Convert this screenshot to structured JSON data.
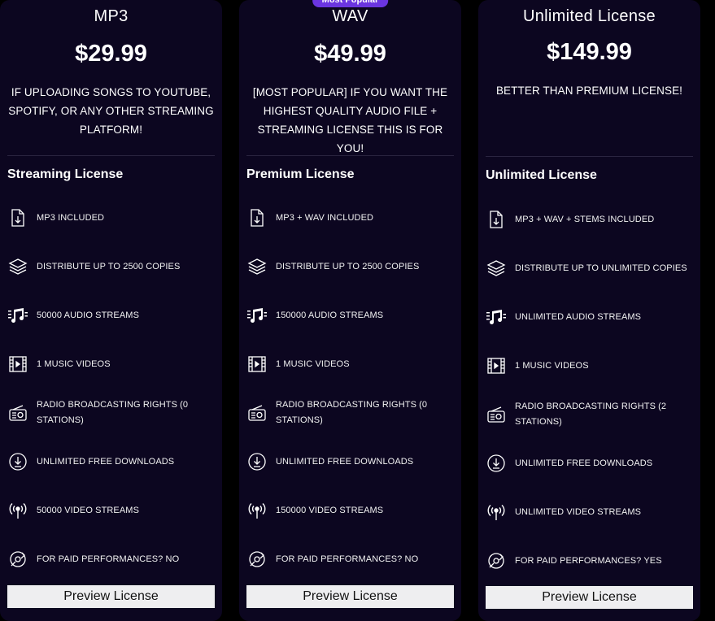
{
  "cards": [
    {
      "name": "MP3",
      "price": "$29.99",
      "description": "IF UPLOADING SONGS TO YOUTUBE, SPOTIFY, OR ANY OTHER STREAMING PLATFORM!",
      "license_title": "Streaming License",
      "features": [
        {
          "icon": "file-download-icon",
          "text": "MP3 INCLUDED"
        },
        {
          "icon": "layers-icon",
          "text": "DISTRIBUTE UP TO 2500 COPIES"
        },
        {
          "icon": "music-note-icon",
          "text": "50000 AUDIO STREAMS"
        },
        {
          "icon": "film-icon",
          "text": "1 MUSIC VIDEOS"
        },
        {
          "icon": "radio-icon",
          "text": "RADIO BROADCASTING RIGHTS (0 STATIONS)"
        },
        {
          "icon": "download-circle-icon",
          "text": "UNLIMITED FREE DOWNLOADS"
        },
        {
          "icon": "broadcast-icon",
          "text": "50000 VIDEO STREAMS"
        },
        {
          "icon": "performance-icon",
          "text": "FOR PAID PERFORMANCES? NO"
        }
      ],
      "button": "Preview License"
    },
    {
      "badge": "Most Popular",
      "name": "WAV",
      "price": "$49.99",
      "description": "[MOST POPULAR] IF YOU WANT THE HIGHEST QUALITY AUDIO FILE + STREAMING LICENSE THIS IS FOR YOU!",
      "license_title": "Premium License",
      "features": [
        {
          "icon": "file-download-icon",
          "text": "MP3 + WAV INCLUDED"
        },
        {
          "icon": "layers-icon",
          "text": "DISTRIBUTE UP TO 2500 COPIES"
        },
        {
          "icon": "music-note-icon",
          "text": "150000 AUDIO STREAMS"
        },
        {
          "icon": "film-icon",
          "text": "1 MUSIC VIDEOS"
        },
        {
          "icon": "radio-icon",
          "text": "RADIO BROADCASTING RIGHTS (0 STATIONS)"
        },
        {
          "icon": "download-circle-icon",
          "text": "UNLIMITED FREE DOWNLOADS"
        },
        {
          "icon": "broadcast-icon",
          "text": "150000 VIDEO STREAMS"
        },
        {
          "icon": "performance-icon",
          "text": "FOR PAID PERFORMANCES? NO"
        }
      ],
      "button": "Preview License"
    },
    {
      "name": "Unlimited License",
      "price": "$149.99",
      "description": "BETTER THAN PREMIUM LICENSE!",
      "license_title": "Unlimited License",
      "features": [
        {
          "icon": "file-download-icon",
          "text": "MP3 + WAV + STEMS INCLUDED"
        },
        {
          "icon": "layers-icon",
          "text": "DISTRIBUTE UP TO UNLIMITED COPIES"
        },
        {
          "icon": "music-note-icon",
          "text": "UNLIMITED AUDIO STREAMS"
        },
        {
          "icon": "film-icon",
          "text": "1 MUSIC VIDEOS"
        },
        {
          "icon": "radio-icon",
          "text": "RADIO BROADCASTING RIGHTS (2 STATIONS)"
        },
        {
          "icon": "download-circle-icon",
          "text": "UNLIMITED FREE DOWNLOADS"
        },
        {
          "icon": "broadcast-icon",
          "text": "UNLIMITED VIDEO STREAMS"
        },
        {
          "icon": "performance-icon",
          "text": "FOR PAID PERFORMANCES? YES"
        }
      ],
      "button": "Preview License"
    }
  ],
  "colors": {
    "card_background": "#0c0620",
    "badge": "#6b35e0",
    "button": "#eeeef0"
  }
}
